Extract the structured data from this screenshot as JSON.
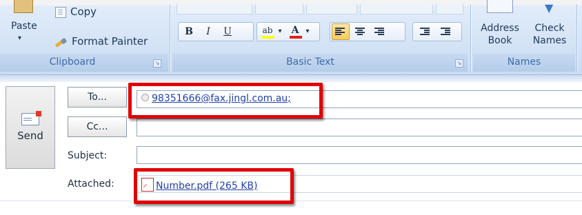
{
  "ribbon": {
    "clipboard": {
      "paste_label": "Paste",
      "paste_arrow": "▾",
      "copy_label": "Copy",
      "format_painter_label": "Format Painter",
      "group_label": "Clipboard"
    },
    "basic_text": {
      "group_label": "Basic Text",
      "bold": "B",
      "italic": "I",
      "underline": "U",
      "highlight": "ab",
      "font_color": "A",
      "dropdown": "▾"
    },
    "names": {
      "address_book_line1": "Address",
      "address_book_line2": "Book",
      "check_names_line1": "Check",
      "check_names_line2": "Names",
      "group_label": "Names"
    },
    "launcher_glyph": "↘"
  },
  "compose": {
    "send_label": "Send",
    "to_button": "To...",
    "cc_button": "Cc...",
    "subject_label": "Subject:",
    "attached_label": "Attached:",
    "to_value": "98351666@fax.jingl.com.au;",
    "cc_value": "",
    "subject_value": "",
    "attachment": "Number.pdf (265 KB)"
  },
  "colors": {
    "highlight_box": "#e00000",
    "link": "#1f3fb0",
    "ribbon_bg": "#d5e4f6"
  }
}
